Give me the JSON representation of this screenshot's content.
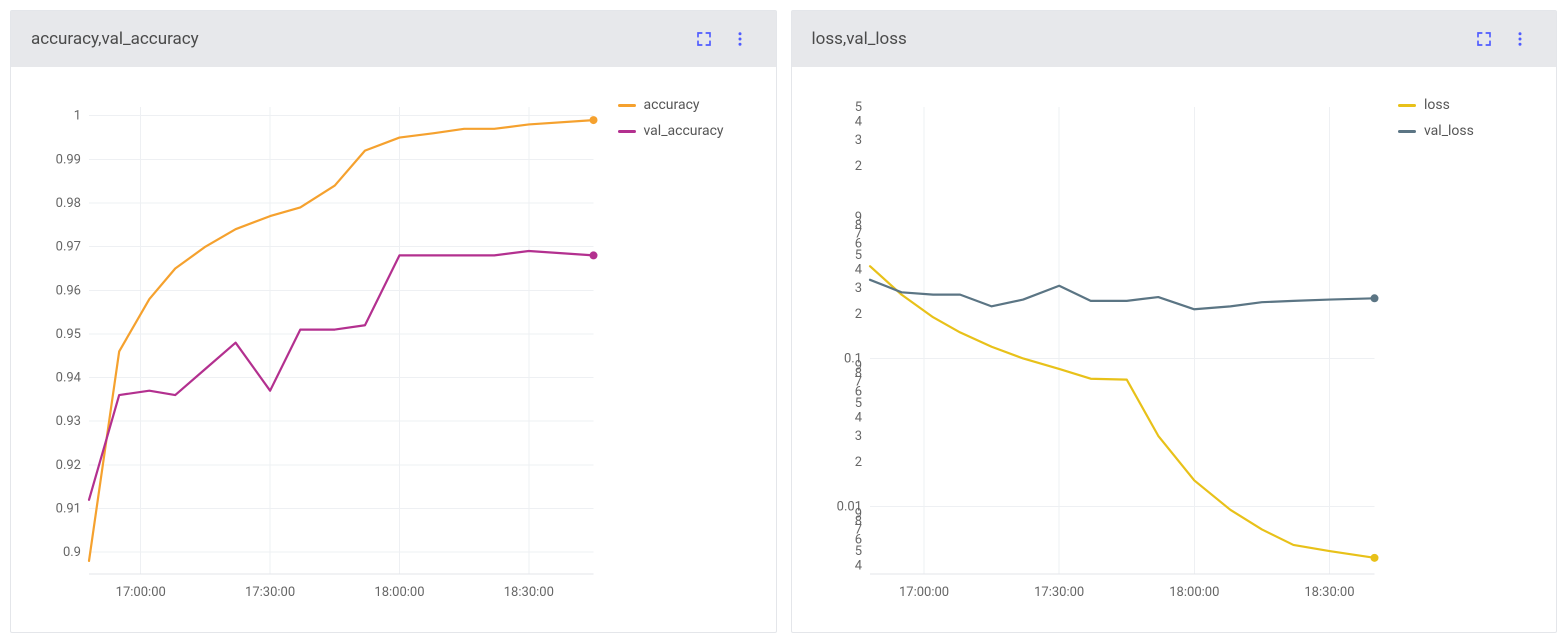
{
  "panels": [
    {
      "title": "accuracy,val_accuracy",
      "legend": [
        {
          "name": "accuracy",
          "color": "#f5a12e"
        },
        {
          "name": "val_accuracy",
          "color": "#b3308f"
        }
      ]
    },
    {
      "title": "loss,val_loss",
      "legend": [
        {
          "name": "loss",
          "color": "#e8c119"
        },
        {
          "name": "val_loss",
          "color": "#5b7584"
        }
      ]
    }
  ],
  "chart_data": [
    {
      "type": "line",
      "title": "accuracy,val_accuracy",
      "xlabel": "",
      "ylabel": "",
      "ylim": [
        0.895,
        1.002
      ],
      "yscale": "linear",
      "yticks": [
        0.9,
        0.91,
        0.92,
        0.93,
        0.94,
        0.95,
        0.96,
        0.97,
        0.98,
        0.99,
        1.0
      ],
      "x": [
        "16:48",
        "16:55",
        "17:02",
        "17:08",
        "17:15",
        "17:22",
        "17:30",
        "17:37",
        "17:45",
        "17:52",
        "18:00",
        "18:08",
        "18:15",
        "18:22",
        "18:30",
        "18:45"
      ],
      "xticks": [
        "17:00:00",
        "17:30:00",
        "18:00:00",
        "18:30:00"
      ],
      "xticks_at": [
        "17:00",
        "17:30",
        "18:00",
        "18:30"
      ],
      "series": [
        {
          "name": "accuracy",
          "color": "#f5a12e",
          "endpoint": true,
          "values": [
            0.898,
            0.946,
            0.958,
            0.965,
            0.97,
            0.974,
            0.977,
            0.979,
            0.984,
            0.992,
            0.995,
            0.996,
            0.997,
            0.997,
            0.998,
            0.999
          ]
        },
        {
          "name": "val_accuracy",
          "color": "#b3308f",
          "endpoint": true,
          "values": [
            0.912,
            0.936,
            0.937,
            0.936,
            0.942,
            0.948,
            0.937,
            0.951,
            0.951,
            0.952,
            0.968,
            0.968,
            0.968,
            0.968,
            0.969,
            0.968
          ]
        }
      ]
    },
    {
      "type": "line",
      "title": "loss,val_loss",
      "xlabel": "",
      "ylabel": "",
      "yscale": "log",
      "ylim": [
        0.0035,
        5.0
      ],
      "yticks_major": [
        0.01,
        0.1
      ],
      "yticks_major_labels": [
        "0.01",
        "0.1"
      ],
      "yticks_minor": [
        0.004,
        0.005,
        0.006,
        0.007,
        0.008,
        0.009,
        0.02,
        0.03,
        0.04,
        0.05,
        0.06,
        0.07,
        0.08,
        0.09,
        0.2,
        0.3,
        0.4,
        0.5,
        0.6,
        0.7,
        0.8,
        0.9,
        2,
        3,
        4,
        5
      ],
      "yticks_minor_labels": [
        "4",
        "5",
        "6",
        "7",
        "8",
        "9",
        "2",
        "3",
        "4",
        "5",
        "6",
        "7",
        "8",
        "9",
        "2",
        "3",
        "4",
        "5",
        "6",
        "7",
        "8",
        "9",
        "2",
        "3",
        "4",
        "5"
      ],
      "x": [
        "16:48",
        "16:55",
        "17:02",
        "17:08",
        "17:15",
        "17:22",
        "17:30",
        "17:37",
        "17:45",
        "17:52",
        "18:00",
        "18:08",
        "18:15",
        "18:22",
        "18:30",
        "18:40"
      ],
      "xticks": [
        "17:00:00",
        "17:30:00",
        "18:00:00",
        "18:30:00"
      ],
      "xticks_at": [
        "17:00",
        "17:30",
        "18:00",
        "18:30"
      ],
      "series": [
        {
          "name": "loss",
          "color": "#e8c119",
          "endpoint": true,
          "values": [
            0.42,
            0.27,
            0.19,
            0.15,
            0.12,
            0.1,
            0.085,
            0.073,
            0.072,
            0.03,
            0.015,
            0.0095,
            0.007,
            0.0055,
            0.005,
            0.0045
          ]
        },
        {
          "name": "val_loss",
          "color": "#5b7584",
          "endpoint": true,
          "values": [
            0.34,
            0.28,
            0.27,
            0.27,
            0.225,
            0.25,
            0.31,
            0.245,
            0.245,
            0.26,
            0.215,
            0.225,
            0.24,
            0.245,
            0.25,
            0.255
          ]
        }
      ]
    }
  ]
}
